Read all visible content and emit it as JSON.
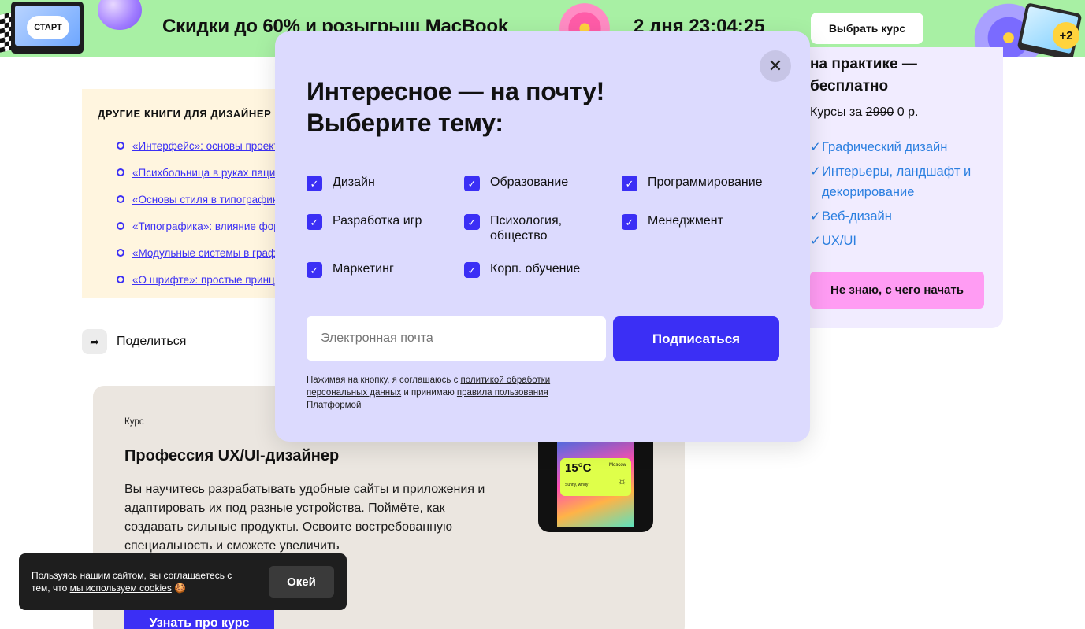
{
  "banner": {
    "start_badge": "СТАРТ",
    "promo": "Скидки до 60% и розыгрыш MacBook",
    "timer": "2 дня 23:04:25",
    "cta": "Выбрать курс",
    "extra_badge": "+2"
  },
  "books": {
    "heading": "ДРУГИЕ КНИГИ ДЛЯ ДИЗАЙНЕР",
    "items": [
      "«Интерфейс»: основы проекти",
      "«Психбольница в руках паци",
      "«Основы стиля в типографике",
      "«Типографика»: влияние фор",
      "«Модульные системы в графи",
      "«О шрифте»: простые принци"
    ]
  },
  "share": {
    "label": "Поделиться"
  },
  "course": {
    "tag": "Курс",
    "title": "Профессия UX/UI-дизайнер",
    "description": "Вы научитесь разрабатывать удобные сайты и приложения и адаптировать их под разные устройства. Поймёте, как создавать сильные продукты. Освоите востребованную специальность и сможете увеличить",
    "button": "Узнать про курс",
    "phone_temp": "15°C",
    "phone_city": "Moscow",
    "phone_sub": "Sunny, windy"
  },
  "side": {
    "heading": "на практике — бесплатно",
    "price_prefix": "Курсы за",
    "price_old": "2990",
    "price_new": "0 р.",
    "items": [
      "Графический дизайн",
      "Интерьеры, ландшафт и декорирование",
      "Веб-дизайн",
      "UX/UI"
    ],
    "button": "Не знаю, с чего начать"
  },
  "modal": {
    "title_line1": "Интересное — на почту!",
    "title_line2": "Выберите тему:",
    "topics": [
      "Дизайн",
      "Образование",
      "Программирование",
      "Разработка игр",
      "Психология, общество",
      "Менеджмент",
      "Маркетинг",
      "Корп. обучение"
    ],
    "email_placeholder": "Электронная почта",
    "subscribe": "Подписаться",
    "legal_1": "Нажимая на кнопку, я соглашаюсь с ",
    "legal_link1": "политикой обработки персональных данных",
    "legal_2": " и принимаю ",
    "legal_link2": "правила пользования Платформой"
  },
  "cookie": {
    "text": "Пользуясь нашим сайтом, вы соглашаетесь с тем, что ",
    "link": "мы используем cookies",
    "emoji": "🍪",
    "ok": "Окей"
  }
}
